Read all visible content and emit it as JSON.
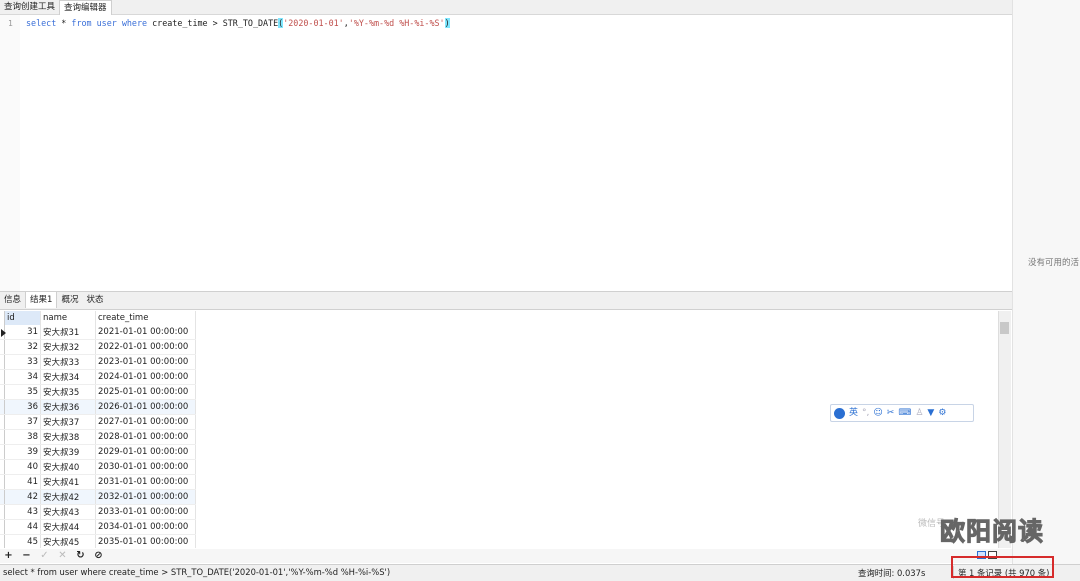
{
  "top_tabs": [
    "查询创建工具",
    "查询编辑器"
  ],
  "editor": {
    "line_number": "1",
    "tokens": [
      {
        "t": "select",
        "c": "kw"
      },
      {
        "t": " * ",
        "c": ""
      },
      {
        "t": "from",
        "c": "kw"
      },
      {
        "t": " ",
        "c": ""
      },
      {
        "t": "user",
        "c": "kw"
      },
      {
        "t": " ",
        "c": ""
      },
      {
        "t": "where",
        "c": "kw"
      },
      {
        "t": " create_time > STR_TO_DATE",
        "c": ""
      },
      {
        "t": "(",
        "c": "paren"
      },
      {
        "t": "'2020-01-01'",
        "c": "str"
      },
      {
        "t": ",",
        "c": ""
      },
      {
        "t": "'%Y-%m-%d %H-%i-%S'",
        "c": "str"
      },
      {
        "t": ")",
        "c": "paren"
      }
    ]
  },
  "right_panel": {
    "text": "没有可用的活"
  },
  "result_tabs": [
    "信息",
    "结果1",
    "概况",
    "状态"
  ],
  "grid": {
    "columns": [
      "id",
      "name",
      "create_time"
    ],
    "rows": [
      [
        "31",
        "安大叔31",
        "2021-01-01 00:00:00"
      ],
      [
        "32",
        "安大叔32",
        "2022-01-01 00:00:00"
      ],
      [
        "33",
        "安大叔33",
        "2023-01-01 00:00:00"
      ],
      [
        "34",
        "安大叔34",
        "2024-01-01 00:00:00"
      ],
      [
        "35",
        "安大叔35",
        "2025-01-01 00:00:00"
      ],
      [
        "36",
        "安大叔36",
        "2026-01-01 00:00:00"
      ],
      [
        "37",
        "安大叔37",
        "2027-01-01 00:00:00"
      ],
      [
        "38",
        "安大叔38",
        "2028-01-01 00:00:00"
      ],
      [
        "39",
        "安大叔39",
        "2029-01-01 00:00:00"
      ],
      [
        "40",
        "安大叔40",
        "2030-01-01 00:00:00"
      ],
      [
        "41",
        "安大叔41",
        "2031-01-01 00:00:00"
      ],
      [
        "42",
        "安大叔42",
        "2032-01-01 00:00:00"
      ],
      [
        "43",
        "安大叔43",
        "2033-01-01 00:00:00"
      ],
      [
        "44",
        "安大叔44",
        "2034-01-01 00:00:00"
      ],
      [
        "45",
        "安大叔45",
        "2035-01-01 00:00:00"
      ]
    ]
  },
  "toolbar": {
    "add": "+",
    "remove": "−",
    "apply": "✓",
    "discard": "✕",
    "refresh": "↻",
    "stop": "⊘"
  },
  "ime": {
    "lang": "英",
    "icons": [
      "punctuation-icon",
      "emoji-icon",
      "scissors-icon",
      "keyboard-icon",
      "user-icon",
      "shirt-icon",
      "gear-icon"
    ]
  },
  "status": {
    "sql": "select * from user where create_time > STR_TO_DATE('2020-01-01','%Y-%m-%d %H-%i-%S')",
    "time": "查询时间: 0.037s",
    "records": "第 1 条记录 (共 970 条)"
  },
  "watermark": {
    "small": "微信号",
    "big": "欧阳阅读"
  },
  "colors": {
    "keyword": "#3a6fd8",
    "string": "#c0504d",
    "highlight": "#d62b2b"
  }
}
